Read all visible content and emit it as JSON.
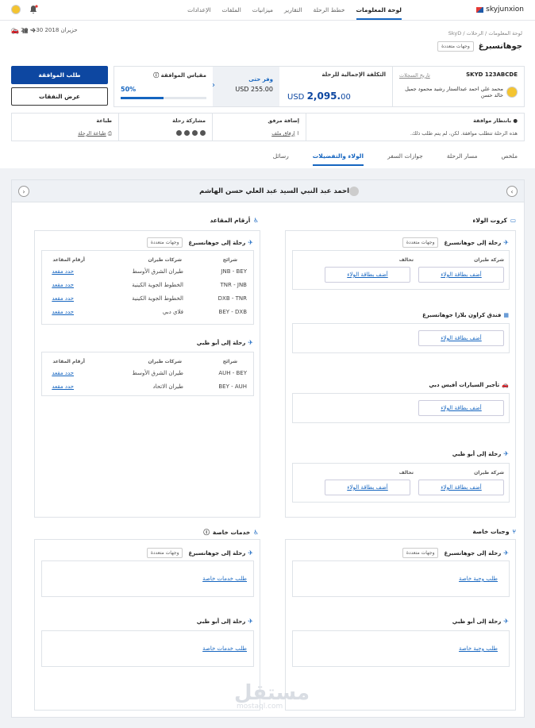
{
  "brand": "skyjunxion",
  "nav": [
    "لوحة المعلومات",
    "خطط الرحلة",
    "التقارير",
    "ميزانيات",
    "الملفات",
    "الإعدادات"
  ],
  "dates": "20 < 30 حزيران 2018",
  "breadcrumb": "لوحة المعلومات / الرحلات / SkyD",
  "title": "جوهانسبرغ",
  "multi_badge": "وجهات متعددة",
  "ref": "SKYD 123ABCDE",
  "history_link": "تاريخ السجلات",
  "travellers": "محمد علي احمد عبدالستار رشيد محمود جميل خالد حسن",
  "total_label": "التكلفة الإجمالية للرحلة",
  "total_currency": "USD",
  "total_value": "2,095.",
  "total_cents": "00",
  "saved_label": "وفر حتى",
  "saved_value": "USD 255.00",
  "approval_label": "مقياس الموافقة",
  "approval_pct": "50%",
  "approval_value": 50,
  "approve_btn": "طلب الموافقة",
  "expenses_btn": "عرض النفقات",
  "info": {
    "warn_h": "بانتظار موافقة",
    "warn_t": "هذه الرحلة تتطلب موافقة. لكن، لم يتم طلب ذلك.",
    "attach_h": "إضافة مرفق",
    "attach_t": "إرفاق ملف",
    "share_h": "مشاركة رحلة",
    "print_h": "طباعة",
    "print_t": "طباعة الرحلة"
  },
  "tabs": [
    "ملخص",
    "مسار الرحلة",
    "جوازات السفر",
    "الولاء والتفضيلات",
    "رسائل"
  ],
  "traveller_name": "احمد عبد النبي السيد عبد العلي حسن الهاشم",
  "loyalty": {
    "title": "كروت الولاء",
    "flight_jnb": "رحلة إلى جوهانسبرغ",
    "col_airline": "شركة طيران",
    "col_alliance": "تحالف",
    "add_card": "أضف بطاقة الولاء",
    "hotel": "فندق كراون بلازا جوهانسبرغ",
    "car": "تأجير السيارات أفيس دبي",
    "flight_auh": "رحلة إلى أبو ظبي"
  },
  "seats": {
    "title": "أرقام المقاعد",
    "flight_jnb": "رحلة إلى جوهانسبرغ",
    "col_seg": "شرائح",
    "col_air": "شركات طيران",
    "col_seat": "أرقام المقاعد",
    "select": "حدد مقعد",
    "jnb_rows": [
      {
        "seg": "JNB - BEY",
        "air": "طيران الشرق الأوسط"
      },
      {
        "seg": "TNR - JNB",
        "air": "الخطوط الجوية الكينية"
      },
      {
        "seg": "DXB - TNR",
        "air": "الخطوط الجوية الكينية"
      },
      {
        "seg": "BEY - DXB",
        "air": "فلاي دبي"
      }
    ],
    "flight_auh": "رحلة إلى أبو ظبي",
    "auh_rows": [
      {
        "seg": "AUH - BEY",
        "air": "طيران الشرق الأوسط"
      },
      {
        "seg": "BEY - AUH",
        "air": "طيران الاتحاد"
      }
    ]
  },
  "meals": {
    "title": "وجبات خاصة",
    "flight_jnb": "رحلة إلى جوهانسبرغ",
    "flight_auh": "رحلة إلى أبو ظبي",
    "req": "طلب وجبة خاصة"
  },
  "services": {
    "title": "خدمات خاصة",
    "flight_jnb": "رحلة إلى جوهانسبرغ",
    "flight_auh": "رحلة إلى أبو ظبي",
    "req": "طلب خدمات خاصة"
  },
  "watermark": "مستقل",
  "watermark2": "mostaql.com"
}
